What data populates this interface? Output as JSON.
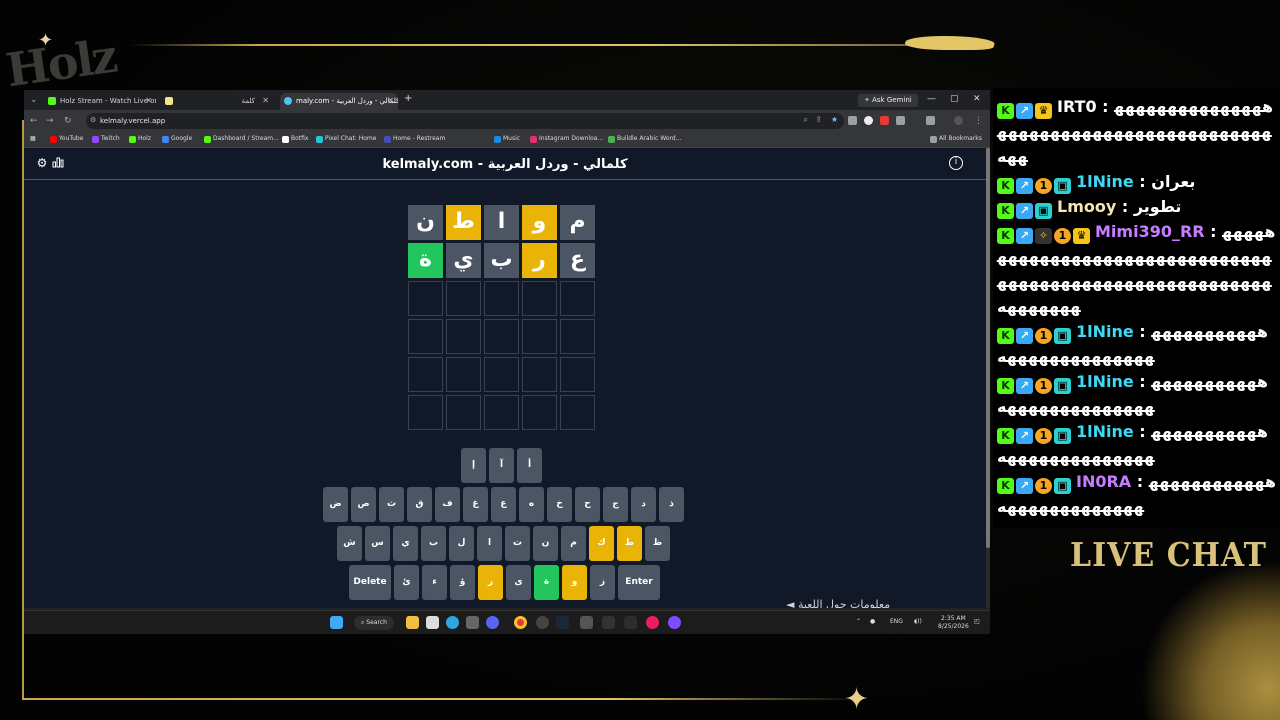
{
  "stream": {
    "logo": "Holz",
    "live_chat": "LIVE CHAT"
  },
  "chat": {
    "messages": [
      {
        "user": "IRT0",
        "user_color": "#ffffff",
        "badges": [
          "k",
          "arrow",
          "crown"
        ],
        "text": "هههههههههههههههههههههههههههههههههههههههههههه"
      },
      {
        "user": "1lNine",
        "user_color": "#3dd9f5",
        "badges": [
          "k",
          "arrow",
          "one",
          "sub"
        ],
        "text": "بعران"
      },
      {
        "user": "Lmooy",
        "user_color": "#f2e7b0",
        "badges": [
          "k",
          "arrow",
          "sub"
        ],
        "text": "تطوير"
      },
      {
        "user": "Mimi390_RR",
        "user_color": "#c77dff",
        "badges": [
          "k",
          "arrow",
          "spark",
          "one",
          "crown"
        ],
        "text": "ههههههههههههههههههههههههههههههههههههههههههههههههههههههههههههههههه"
      },
      {
        "user": "1lNine",
        "user_color": "#3dd9f5",
        "badges": [
          "k",
          "arrow",
          "one",
          "sub"
        ],
        "text": "هههههههههههههههههههههههههه"
      },
      {
        "user": "1lNine",
        "user_color": "#3dd9f5",
        "badges": [
          "k",
          "arrow",
          "one",
          "sub"
        ],
        "text": "هههههههههههههههههههههههههه"
      },
      {
        "user": "1lNine",
        "user_color": "#3dd9f5",
        "badges": [
          "k",
          "arrow",
          "one",
          "sub"
        ],
        "text": "هههههههههههههههههههههههههه"
      },
      {
        "user": "IN0RA",
        "user_color": "#c77dff",
        "badges": [
          "k",
          "arrow",
          "one",
          "sub"
        ],
        "text": "هههههههههههههههههههههههههه"
      }
    ]
  },
  "browser": {
    "tabs": [
      {
        "label": "Holz Stream - Watch Live on Ki",
        "fav_color": "#53fc18",
        "active": false
      },
      {
        "label": "كلمة",
        "fav_color": "#f0e68c",
        "active": false
      },
      {
        "label": "maly.com - كلمالي - وردل العربية",
        "fav_color": "#4fc3f7",
        "active": true
      }
    ],
    "new_tab": "+",
    "ask_gemini": "Ask Gemini",
    "url": "kelmaly.vercel.app",
    "window_controls": {
      "minimize": "—",
      "maximize": "▢",
      "close": "✕"
    },
    "bookmarks": [
      {
        "label": "YouTube",
        "color": "#ff0000"
      },
      {
        "label": "Twitch",
        "color": "#9146ff"
      },
      {
        "label": "Holz",
        "color": "#53fc18"
      },
      {
        "label": "Google",
        "color": "#4285f4"
      },
      {
        "label": "Dashboard / Stream...",
        "color": "#53fc18"
      },
      {
        "label": "Botfix",
        "color": "#ffffff"
      },
      {
        "label": "Pixel Chat: Home",
        "color": "#26c6da"
      },
      {
        "label": "Home - Restream",
        "color": "#3f51b5"
      },
      {
        "label": "Music",
        "color": "#1e88e5"
      },
      {
        "label": "Instagram Downloa...",
        "color": "#e1306c"
      },
      {
        "label": "Buildle Arabic Word...",
        "color": "#4caf50"
      }
    ],
    "all_bookmarks": "All Bookmarks"
  },
  "game": {
    "title": "kelmaly.com - كلمالي - وردل العربية",
    "colors": {
      "yellow": "#eab308",
      "green": "#22c55e",
      "gray": "#4b5563"
    },
    "rows": [
      [
        {
          "letter": "ن",
          "state": "gray"
        },
        {
          "letter": "ط",
          "state": "yellow"
        },
        {
          "letter": "ا",
          "state": "gray"
        },
        {
          "letter": "و",
          "state": "yellow"
        },
        {
          "letter": "م",
          "state": "gray"
        }
      ],
      [
        {
          "letter": "ة",
          "state": "green"
        },
        {
          "letter": "ي",
          "state": "gray"
        },
        {
          "letter": "ب",
          "state": "gray"
        },
        {
          "letter": "ر",
          "state": "yellow"
        },
        {
          "letter": "ع",
          "state": "gray"
        }
      ]
    ],
    "keyboard": {
      "row1": [
        "إ",
        "آ",
        "أ"
      ],
      "row2": [
        "ض",
        "ص",
        "ث",
        "ق",
        "ف",
        "غ",
        "ع",
        "ه",
        "خ",
        "ح",
        "ج",
        "د",
        "ذ"
      ],
      "row3": [
        "ش",
        "س",
        "ي",
        "ب",
        "ل",
        "ا",
        "ت",
        "ن",
        "م",
        "ك",
        "ط",
        "ظ"
      ],
      "row4": [
        "Delete",
        "ئ",
        "ء",
        "ؤ",
        "ر",
        "ى",
        "ة",
        "و",
        "ز",
        "Enter"
      ],
      "highlight": {
        "ك": "yellow",
        "ط": "yellow",
        "ر": "yellow",
        "ة": "green",
        "و": "yellow"
      }
    },
    "bottom_text": "◄ معلومات حول اللعبة"
  },
  "taskbar": {
    "search": "Search",
    "lang": "ENG",
    "time": "2:35 AM",
    "date": "8/25/2026"
  }
}
